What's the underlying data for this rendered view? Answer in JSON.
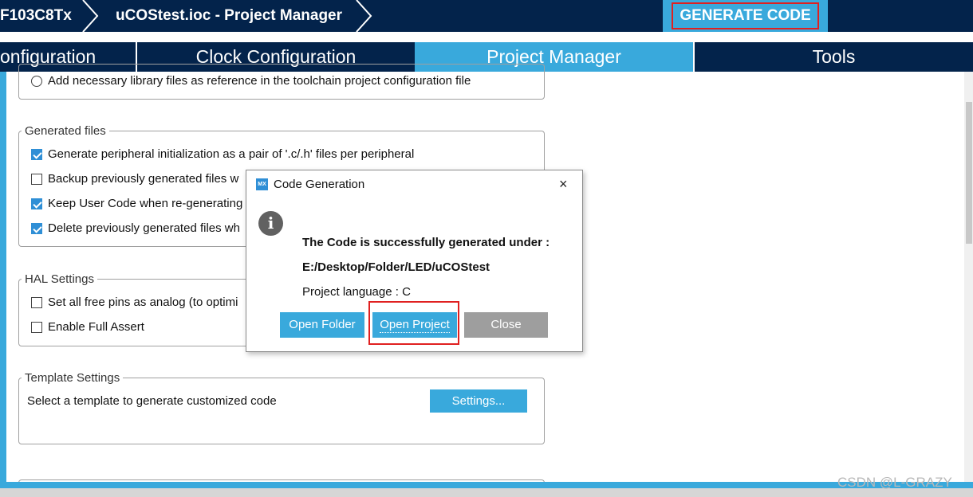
{
  "header": {
    "breadcrumb_mcu": "F103C8Tx",
    "breadcrumb_project": "uCOStest.ioc - Project Manager",
    "generate_code_label": "GENERATE CODE"
  },
  "tabs": [
    {
      "label": "onfiguration",
      "active": false
    },
    {
      "label": "Clock Configuration",
      "active": false
    },
    {
      "label": "Project Manager",
      "active": true
    },
    {
      "label": "Tools",
      "active": false
    }
  ],
  "sections": {
    "toolchain_option": "Add necessary library files as reference in the toolchain project configuration file",
    "generated_files": {
      "title": "Generated files",
      "options": [
        {
          "label": "Generate peripheral initialization as a pair of '.c/.h' files per peripheral",
          "checked": true
        },
        {
          "label": "Backup previously generated files w",
          "checked": false
        },
        {
          "label": "Keep User Code when re-generating",
          "checked": true
        },
        {
          "label": "Delete previously generated files wh",
          "checked": true
        }
      ]
    },
    "hal_settings": {
      "title": "HAL Settings",
      "options": [
        {
          "label": "Set all free pins as analog (to optimi",
          "checked": false
        },
        {
          "label": "Enable Full Assert",
          "checked": false
        }
      ]
    },
    "template_settings": {
      "title": "Template Settings",
      "description": "Select a template to generate customized code",
      "settings_button": "Settings..."
    }
  },
  "dialog": {
    "icon_label": "MX",
    "title": "Code Generation",
    "close_glyph": "×",
    "info_glyph": "i",
    "message": "The Code is successfully generated under :",
    "path": "E:/Desktop/Folder/LED/uCOStest",
    "language": "Project language : C",
    "buttons": {
      "open_folder": "Open Folder",
      "open_project": "Open Project",
      "close": "Close"
    }
  },
  "watermark": "CSDN @L-GRAZY",
  "colors": {
    "navy": "#03234b",
    "accent_blue": "#39a9dc",
    "highlight_red": "#e02020",
    "grey_button": "#9e9e9e"
  }
}
